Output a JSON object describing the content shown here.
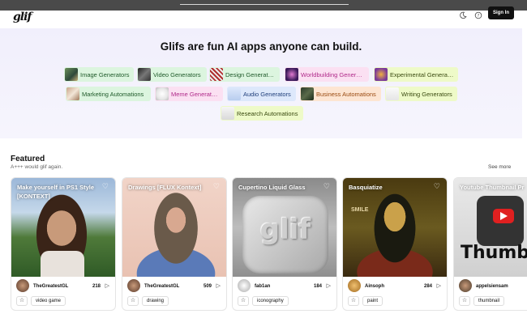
{
  "header": {
    "logo": "glif",
    "sign_in": "Sign In",
    "theme_icon": "moon-icon",
    "help_icon": "help-icon"
  },
  "hero": {
    "title": "Glifs are fun AI apps anyone can build.",
    "categories": [
      {
        "label": "Image Generators",
        "color": "#1f5a2a",
        "bg": "#dcf5df"
      },
      {
        "label": "Video Generators",
        "color": "#1f5a2a",
        "bg": "#dcf5df"
      },
      {
        "label": "Design Generators",
        "color": "#1f5a2a",
        "bg": "#dcf5df"
      },
      {
        "label": "Worldbuilding Generat...",
        "color": "#b02a8a",
        "bg": "#fbe0f2"
      },
      {
        "label": "Experimental Generat...",
        "color": "#3a4a10",
        "bg": "#eefac8"
      },
      {
        "label": "Marketing Automations",
        "color": "#1f5a2a",
        "bg": "#dcf5df"
      },
      {
        "label": "Meme Generators",
        "color": "#b02a8a",
        "bg": "#fbe0f2"
      },
      {
        "label": "Audio Generators",
        "color": "#1f3e7a",
        "bg": "#dde8fb"
      },
      {
        "label": "Business Automations",
        "color": "#9a4a10",
        "bg": "#fde5d2"
      },
      {
        "label": "Writing Generators",
        "color": "#3a4a10",
        "bg": "#eefac8"
      },
      {
        "label": "Research Automations",
        "color": "#3a4a10",
        "bg": "#eefac8"
      }
    ]
  },
  "featured": {
    "title": "Featured",
    "subtitle": "A+++ would glif again.",
    "see_more": "See more",
    "cards": [
      {
        "title": "Make yourself in PS1 Style [KONTEXT]",
        "author": "TheGreatestGL",
        "count": "218",
        "tag": "video game"
      },
      {
        "title": "Drawings [FLUX Kontext]",
        "author": "TheGreatestGL",
        "count": "509",
        "tag": "drawing"
      },
      {
        "title": "Cupertino Liquid Glass",
        "author": "fab1an",
        "count": "184",
        "tag": "iconography"
      },
      {
        "title": "Basquiatize",
        "author": "Ainsoph",
        "count": "284",
        "tag": "paint"
      },
      {
        "title": "Youtube Thumbnail Pr",
        "author": "appelsiensam",
        "count": "",
        "tag": "thumbnail"
      }
    ]
  }
}
